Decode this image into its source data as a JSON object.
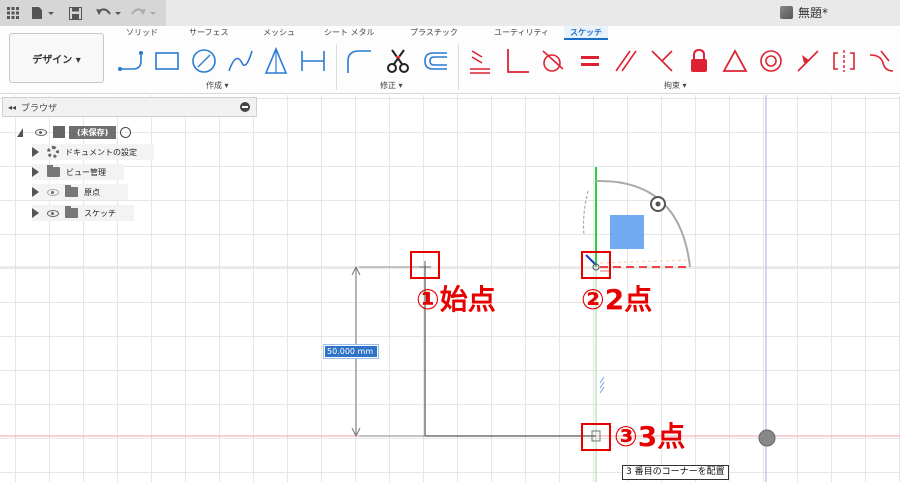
{
  "window": {
    "document_title": "無題*"
  },
  "ribbon": {
    "tabs": [
      "ソリッド",
      "サーフェス",
      "メッシュ",
      "シート メタル",
      "プラスチック",
      "ユーティリティ",
      "スケッチ"
    ],
    "active_tab": "スケッチ",
    "design_button": "デザイン ▾",
    "groups": {
      "create": "作成 ▾",
      "modify": "修正 ▾",
      "constraints": "拘束 ▾"
    }
  },
  "browser": {
    "title": "ブラウザ",
    "items": [
      {
        "label": "(未保存)",
        "icon": "component-icon"
      },
      {
        "label": "ドキュメントの設定",
        "icon": "gear-icon"
      },
      {
        "label": "ビュー管理",
        "icon": "folder-icon"
      },
      {
        "label": "原点",
        "icon": "folder-icon"
      },
      {
        "label": "スケッチ",
        "icon": "folder-icon"
      }
    ]
  },
  "canvas": {
    "dimension_value": "50.000 mm",
    "tooltip": "3 番目のコーナーを配置",
    "annotations": {
      "start": "①始点",
      "second": "②2点",
      "third": "③3点"
    }
  },
  "colors": {
    "accent": "#1a6fc4",
    "annotation_red": "#e60000",
    "x_axis": "#e05050",
    "y_axis": "#2ecc40"
  }
}
